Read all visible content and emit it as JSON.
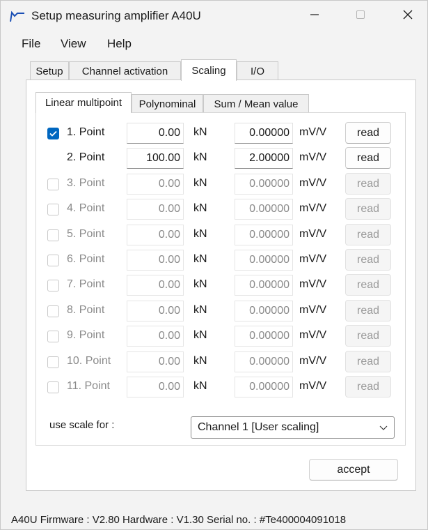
{
  "window": {
    "title": "Setup measuring amplifier A40U"
  },
  "menu": [
    "File",
    "View",
    "Help"
  ],
  "top_tabs": [
    "Setup",
    "Channel activation",
    "Scaling",
    "I/O"
  ],
  "inner_tabs": [
    "Linear multipoint",
    "Polynominal",
    "Sum / Mean value"
  ],
  "units": {
    "force": "kN",
    "signal": "mV/V"
  },
  "read_label": "read",
  "points": [
    {
      "label": "1. Point",
      "force": "0.00",
      "signal": "0.00000",
      "checked": true,
      "enabled": true,
      "has_checkbox": true
    },
    {
      "label": "2. Point",
      "force": "100.00",
      "signal": "2.00000",
      "checked": false,
      "enabled": true,
      "has_checkbox": false
    },
    {
      "label": "3. Point",
      "force": "0.00",
      "signal": "0.00000",
      "checked": false,
      "enabled": false,
      "has_checkbox": true
    },
    {
      "label": "4. Point",
      "force": "0.00",
      "signal": "0.00000",
      "checked": false,
      "enabled": false,
      "has_checkbox": true
    },
    {
      "label": "5. Point",
      "force": "0.00",
      "signal": "0.00000",
      "checked": false,
      "enabled": false,
      "has_checkbox": true
    },
    {
      "label": "6. Point",
      "force": "0.00",
      "signal": "0.00000",
      "checked": false,
      "enabled": false,
      "has_checkbox": true
    },
    {
      "label": "7. Point",
      "force": "0.00",
      "signal": "0.00000",
      "checked": false,
      "enabled": false,
      "has_checkbox": true
    },
    {
      "label": "8. Point",
      "force": "0.00",
      "signal": "0.00000",
      "checked": false,
      "enabled": false,
      "has_checkbox": true
    },
    {
      "label": "9. Point",
      "force": "0.00",
      "signal": "0.00000",
      "checked": false,
      "enabled": false,
      "has_checkbox": true
    },
    {
      "label": "10. Point",
      "force": "0.00",
      "signal": "0.00000",
      "checked": false,
      "enabled": false,
      "has_checkbox": true
    },
    {
      "label": "11. Point",
      "force": "0.00",
      "signal": "0.00000",
      "checked": false,
      "enabled": false,
      "has_checkbox": true
    }
  ],
  "scale": {
    "label": "use scale for :",
    "value": "Channel 1 [User scaling]"
  },
  "accept_label": "accept",
  "status": "A40U  Firmware : V2.80  Hardware : V1.30  Serial no. : #Te400004091018",
  "colors": {
    "accent": "#0067c0",
    "window_bg": "#f3f3f3",
    "disabled_text": "#8a8a8a"
  }
}
